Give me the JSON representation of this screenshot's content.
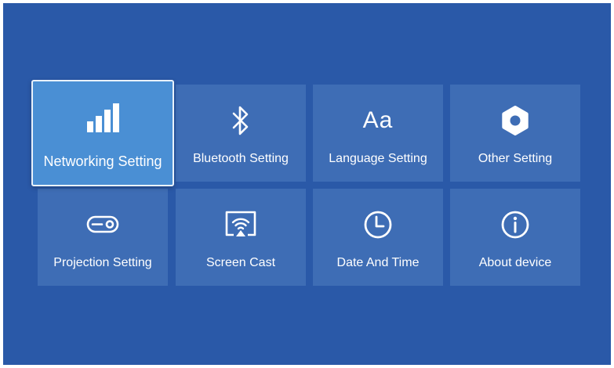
{
  "settings_menu": {
    "tiles": [
      {
        "label": "Networking Setting",
        "icon": "signal-bars-icon",
        "selected": true
      },
      {
        "label": "Bluetooth Setting",
        "icon": "bluetooth-icon",
        "selected": false
      },
      {
        "label": "Language Setting",
        "icon": "language-aa-icon",
        "icon_text": "Aa",
        "selected": false
      },
      {
        "label": "Other Setting",
        "icon": "gear-icon",
        "selected": false
      },
      {
        "label": "Projection Setting",
        "icon": "projector-icon",
        "selected": false
      },
      {
        "label": "Screen Cast",
        "icon": "screen-cast-icon",
        "selected": false
      },
      {
        "label": "Date And Time",
        "icon": "clock-icon",
        "selected": false
      },
      {
        "label": "About device",
        "icon": "info-icon",
        "selected": false
      }
    ]
  },
  "colors": {
    "background": "#2a59a8",
    "tile": "#3e6db5",
    "tile_selected": "#4a8fd4",
    "text": "#ffffff"
  }
}
